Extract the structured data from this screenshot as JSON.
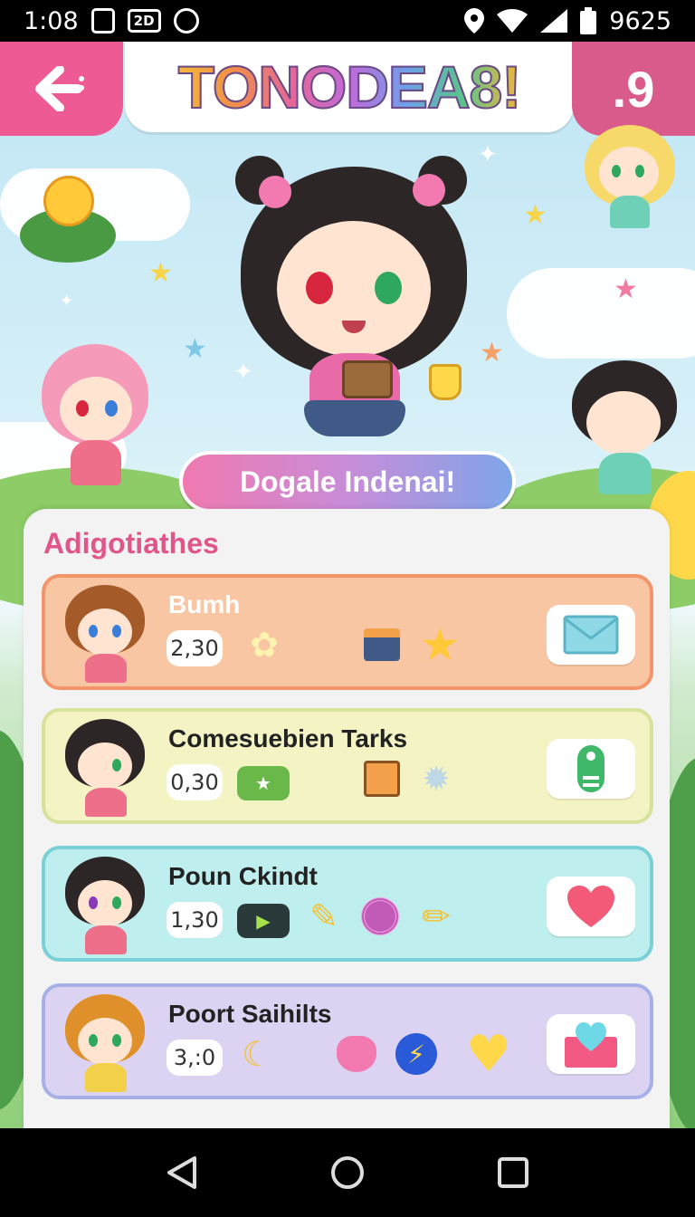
{
  "status_bar": {
    "time": "1:08",
    "box_badge": "2D",
    "battery_text": "9625"
  },
  "header": {
    "title": "TONODEA8!",
    "score": ".9"
  },
  "main_button_label": "Dogale Indenai!",
  "panel": {
    "title": "Adigotiathes",
    "items": [
      {
        "name": "Bumh",
        "value": "2,30"
      },
      {
        "name": "Comesuebien Tarks",
        "value": "0,30"
      },
      {
        "name": "Poun Ckindt",
        "value": "1,30"
      },
      {
        "name": "Poort Saihilts",
        "value": "3,:0"
      }
    ]
  },
  "colors": {
    "accent_pink": "#ee5a93",
    "card_orange": "#f9c6a4",
    "card_yellow": "#f3f3c4",
    "card_cyan": "#bfeeee",
    "card_lilac": "#dcd2f2"
  },
  "icons": [
    "back-arrow-icon",
    "envelope-icon",
    "tag-icon",
    "heart-icon",
    "heart-envelope-icon",
    "star-icon",
    "back-triangle-icon",
    "home-circle-icon",
    "recents-square-icon"
  ]
}
